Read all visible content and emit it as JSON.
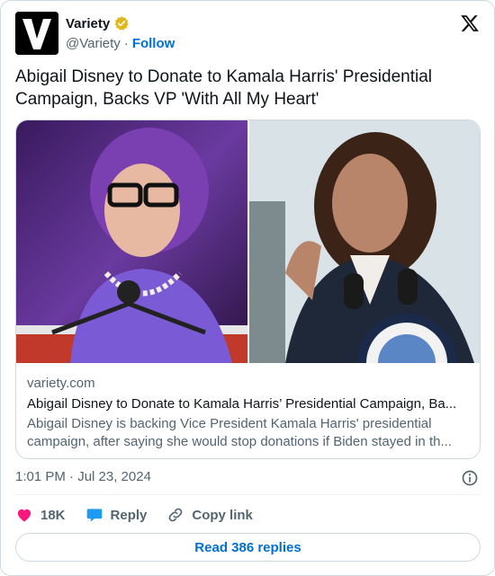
{
  "account": {
    "name": "Variety",
    "handle": "@Variety",
    "separator": "·",
    "follow_label": "Follow",
    "verified_color": "#e2b719"
  },
  "tweet": {
    "text": "Abigail Disney to Donate to Kamala Harris' Presidential Campaign, Backs VP 'With All My Heart'"
  },
  "link_card": {
    "domain": "variety.com",
    "title": "Abigail Disney to Donate to Kamala Harris’ Presidential Campaign, Ba...",
    "description": "Abigail Disney is backing Vice President Kamala Harris' presidential campaign, after saying she would stop donations if Biden stayed in th..."
  },
  "meta": {
    "timestamp": "1:01 PM · Jul 23, 2024"
  },
  "actions": {
    "likes": "18K",
    "reply_label": "Reply",
    "copy_link_label": "Copy link"
  },
  "footer": {
    "read_replies_label": "Read 386 replies"
  },
  "colors": {
    "accent": "#006fd6",
    "like": "#f91880",
    "reply_icon": "#1d9bf0",
    "secondary_text": "#536471"
  },
  "icons": [
    "variety-logo",
    "verified-badge-icon",
    "x-logo-icon",
    "info-icon",
    "heart-icon",
    "reply-bubble-icon",
    "link-icon"
  ]
}
